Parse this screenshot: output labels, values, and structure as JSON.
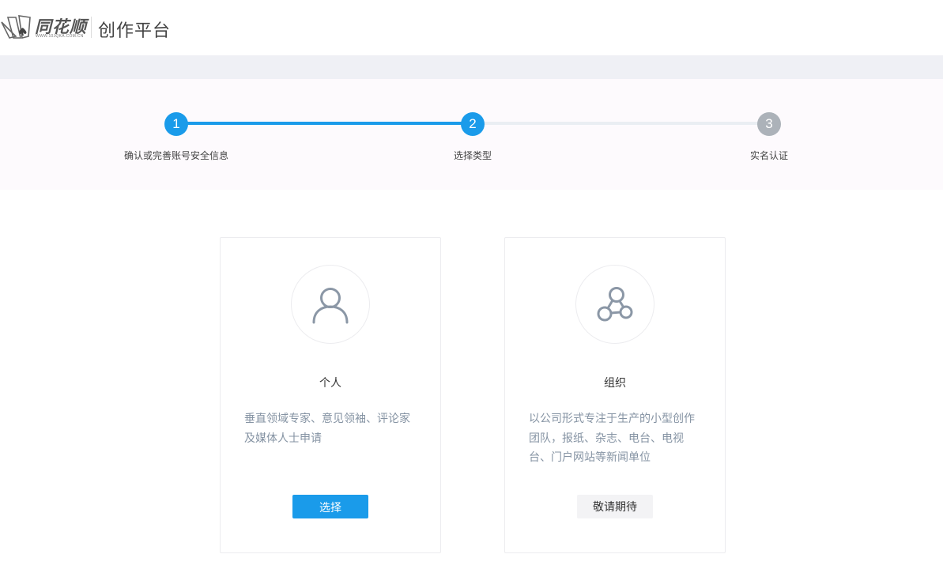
{
  "header": {
    "logo_text": "同花顺",
    "logo_url": "WWW.10JQKA.COM.CN",
    "platform_title": "创作平台"
  },
  "steps": [
    {
      "number": "1",
      "label": "确认或完善账号安全信息",
      "state": "done"
    },
    {
      "number": "2",
      "label": "选择类型",
      "state": "current"
    },
    {
      "number": "3",
      "label": "实名认证",
      "state": "todo"
    }
  ],
  "cards": {
    "personal": {
      "icon": "user-icon",
      "title": "个人",
      "desc_lines": [
        "垂直领域专家、意见领袖、评论家",
        "及媒体人士申请"
      ],
      "button_label": "选择"
    },
    "organization": {
      "icon": "organization-icon",
      "title": "组织",
      "desc_lines": [
        "以公司形式专注于生产的小型创作",
        "团队，报纸、杂志、电台、电视",
        "台、门户网站等新闻单位"
      ],
      "button_label": "敬请期待"
    }
  },
  "colors": {
    "accent": "#1a9bea",
    "inactive_step": "#acb2b9",
    "description_text": "#8593a3",
    "icon_stroke": "#8b97a6"
  }
}
